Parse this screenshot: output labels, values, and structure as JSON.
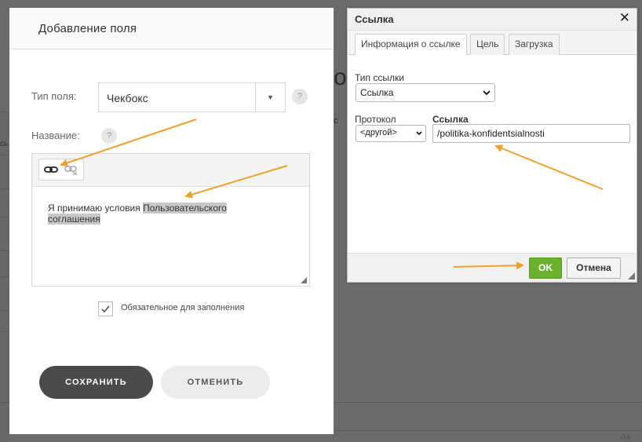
{
  "background": {
    "side_text": "сь",
    "big_text": "о",
    "small_text": "с",
    "bottom_text": "Ак"
  },
  "field_dialog": {
    "title": "Добавление поля",
    "type_label": "Тип поля:",
    "type_value": "Чекбокс",
    "name_label": "Название:",
    "help_glyph": "?",
    "editor_text_plain": "Я принимаю условия ",
    "editor_text_linked_1": "Пользовательского",
    "editor_text_linked_2": "соглашения",
    "required_label": "Обязательное для заполнения",
    "required_checked": true,
    "save_label": "СОХРАНИТЬ",
    "cancel_label": "ОТМЕНИТЬ"
  },
  "link_dialog": {
    "title": "Ссылка",
    "close_glyph": "✕",
    "tabs": [
      {
        "label": "Информация о ссылке",
        "active": true
      },
      {
        "label": "Цель",
        "active": false
      },
      {
        "label": "Загрузка",
        "active": false
      }
    ],
    "link_type_label": "Тип ссылки",
    "link_type_value": "Ссылка",
    "protocol_label": "Протокол",
    "protocol_value": "<другой>",
    "url_label": "Ссылка",
    "url_value": "/politika-konfidentsialnosti",
    "ok_label": "OK",
    "cancel_label": "Отмена"
  },
  "colors": {
    "ok_green": "#6bb12b",
    "arrow_orange": "#f0a030",
    "save_dark": "#4a4a4a"
  }
}
